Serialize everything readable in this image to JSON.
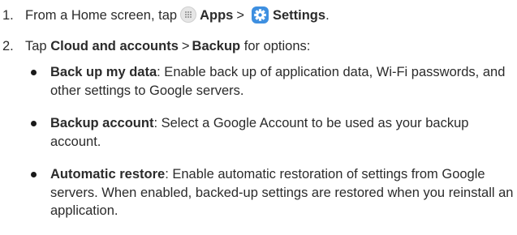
{
  "steps": [
    {
      "number": "1.",
      "prefix": "From a Home screen, tap",
      "apps_label": "Apps",
      "separator": ">",
      "settings_label": "Settings",
      "suffix": ".",
      "icons": [
        "apps-grid-icon",
        "settings-gear-icon"
      ]
    },
    {
      "number": "2.",
      "prefix": "Tap",
      "item1": "Cloud and accounts",
      "separator": ">",
      "item2": "Backup",
      "suffix": "for options:"
    }
  ],
  "bullets": [
    {
      "term": "Back up my data",
      "text": ": Enable back up of application data, Wi-Fi passwords, and other settings to Google servers."
    },
    {
      "term": "Backup account",
      "text": ": Select a Google Account to be used as your backup account."
    },
    {
      "term": "Automatic restore",
      "text": ": Enable automatic restoration of settings from Google servers. When enabled, backed-up settings are restored when you reinstall an application."
    }
  ],
  "colors": {
    "text": "#2b2b2b",
    "settings_icon_bg": "#3e8fe0",
    "apps_icon_bg": "#e6e6e6"
  }
}
